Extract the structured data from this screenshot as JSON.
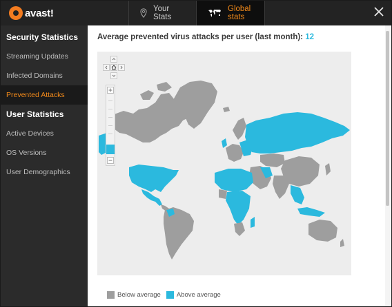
{
  "app": {
    "logo_text": "avast!"
  },
  "tabs": [
    {
      "label": "Your Stats",
      "icon": "map-pin-icon",
      "active": false
    },
    {
      "label": "Global stats",
      "icon": "world-map-icon",
      "active": true
    }
  ],
  "sidebar": {
    "security_title": "Security Statistics",
    "security_items": [
      {
        "label": "Streaming Updates",
        "active": false
      },
      {
        "label": "Infected Domains",
        "active": false
      },
      {
        "label": "Prevented Attacks",
        "active": true
      }
    ],
    "user_title": "User Statistics",
    "user_items": [
      {
        "label": "Active Devices",
        "active": false
      },
      {
        "label": "OS Versions",
        "active": false
      },
      {
        "label": "User Demographics",
        "active": false
      }
    ]
  },
  "main": {
    "headline": "Average prevented virus attacks per user (last month):",
    "headline_value": "12",
    "legend": [
      {
        "label": "Below average",
        "color": "#9e9e9e"
      },
      {
        "label": "Above average",
        "color": "#2bb9de"
      }
    ]
  },
  "colors": {
    "accent": "#f28a1a",
    "above": "#2bb9de",
    "below": "#9e9e9e",
    "ocean": "#ededed"
  }
}
